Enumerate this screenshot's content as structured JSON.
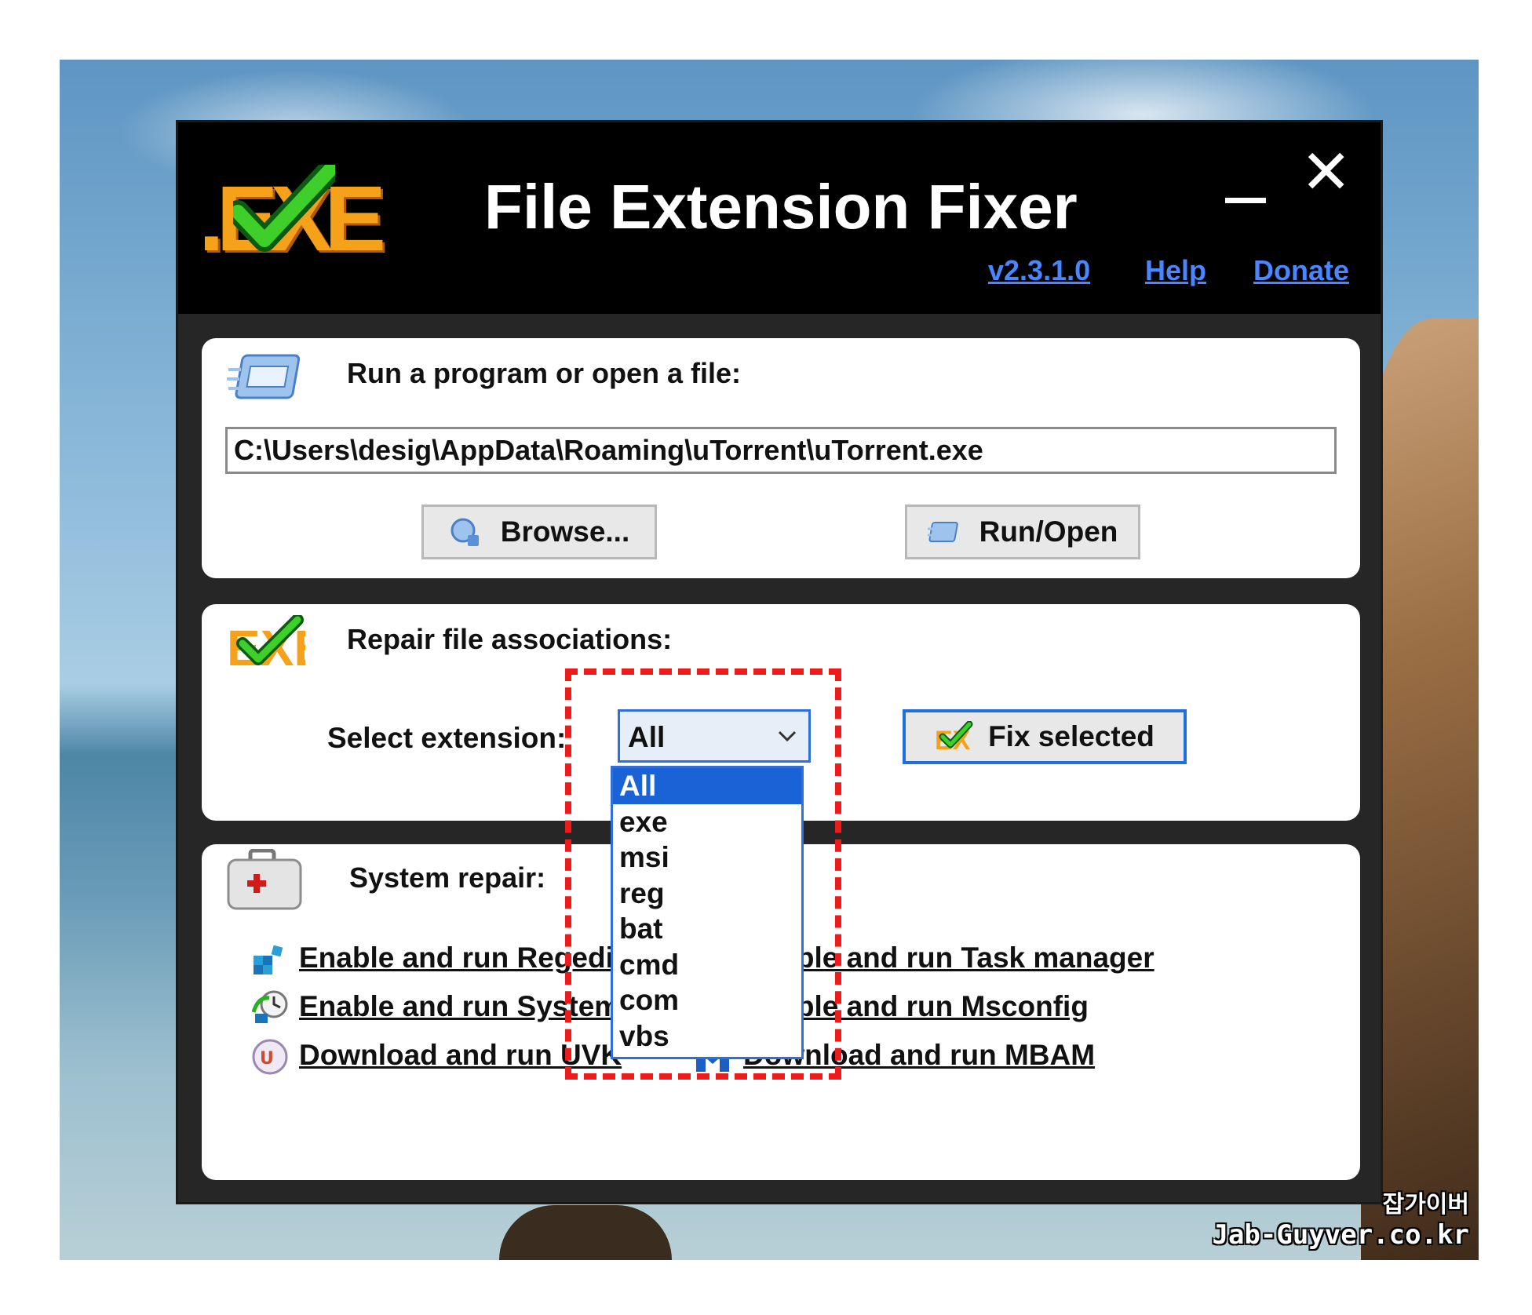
{
  "app": {
    "logo_text": ".EXE",
    "title": "File Extension Fixer",
    "links": {
      "version": "v2.3.1.0",
      "help": "Help",
      "donate": "Donate"
    },
    "window_controls": {
      "minimize_icon": "minimize-icon",
      "close_glyph": "✕"
    }
  },
  "run_section": {
    "label": "Run a program or open a file:",
    "path_value": "C:\\Users\\desig\\AppData\\Roaming\\uTorrent\\uTorrent.exe",
    "browse_label": "Browse...",
    "run_label": "Run/Open"
  },
  "repair_section": {
    "label": "Repair file associations:",
    "select_label": "Select extension:",
    "selected_value": "All",
    "options": [
      "All",
      "exe",
      "msi",
      "reg",
      "bat",
      "cmd",
      "com",
      "vbs"
    ],
    "fix_label": "Fix selected"
  },
  "system_section": {
    "label": "System repair:",
    "links": {
      "regedit": "Enable and run Regedit",
      "system_restore": "Enable and run System",
      "uvk": "Download and run UVK",
      "task_manager": "Enable and run Task manager",
      "msconfig": "Enable and run Msconfig",
      "mbam": "Download and run MBAM"
    }
  },
  "watermark": {
    "line1": "잡가이버",
    "line2": "Jab-Guyver.co.kr"
  },
  "colors": {
    "link_blue": "#4a86ff",
    "highlight_red": "#ef1b1b",
    "select_blue": "#1a63d6",
    "logo_orange": "#f5a21a"
  }
}
